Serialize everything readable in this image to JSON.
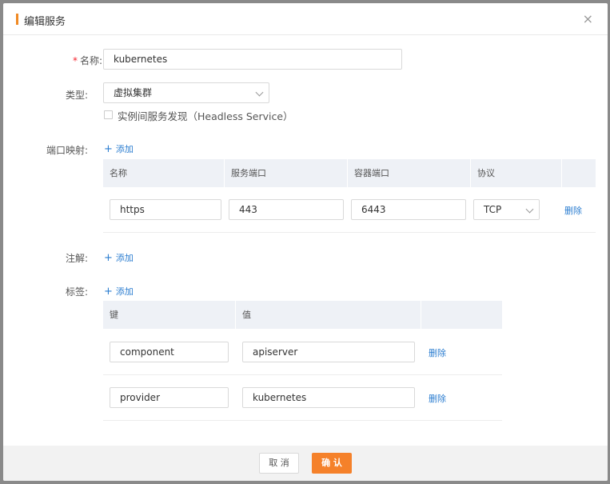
{
  "dialog": {
    "title": "编辑服务",
    "close_glyph": "×"
  },
  "form": {
    "name_label": "名称:",
    "name_required": "*",
    "name_value": "kubernetes",
    "type_label": "类型:",
    "type_value": "虚拟集群",
    "headless_label": "实例间服务发现（Headless Service）",
    "ports_label": "端口映射:",
    "annotations_label": "注解:",
    "labels_label": "标签:",
    "add_text": "添加",
    "add_glyph": "+"
  },
  "ports_table": {
    "headers": [
      "名称",
      "服务端口",
      "容器端口",
      "协议"
    ],
    "rows": [
      {
        "name": "https",
        "service_port": "443",
        "container_port": "6443",
        "protocol": "TCP",
        "delete": "删除"
      }
    ]
  },
  "labels_table": {
    "headers": [
      "键",
      "值"
    ],
    "rows": [
      {
        "key": "component",
        "value": "apiserver",
        "delete": "删除"
      },
      {
        "key": "provider",
        "value": "kubernetes",
        "delete": "删除"
      }
    ]
  },
  "footer": {
    "cancel_label": "取 消",
    "ok_label": "确 认"
  },
  "colors": {
    "accent": "#f5812a",
    "link": "#2b7dd0",
    "table_header": "#eef1f6"
  },
  "icons": [
    "close-icon",
    "chevron-down-icon",
    "plus-icon"
  ]
}
